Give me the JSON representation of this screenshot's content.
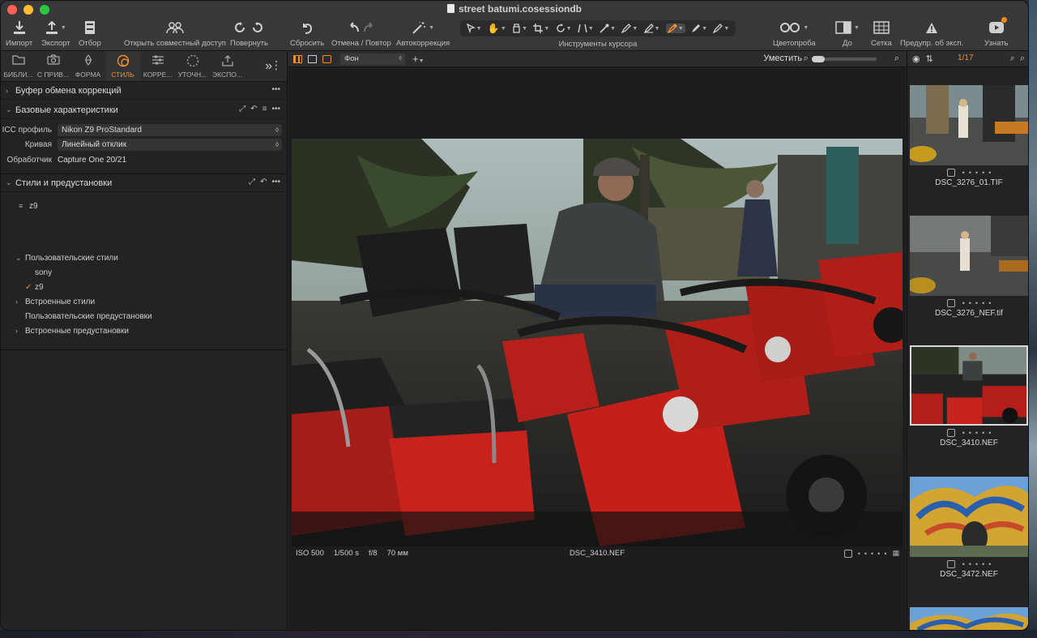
{
  "window": {
    "title": "street batumi.cosessiondb"
  },
  "toolbar": {
    "import": "Импорт",
    "export": "Экспорт",
    "select": "Отбор",
    "share": "Открыть совместный доступ",
    "rotate": "Повернуть",
    "reset": "Сбросить",
    "undo_redo": "Отмена / Повтор",
    "auto": "Автокоррекция",
    "cursor_tools": "Инструменты курсора",
    "color_picker": "Цветопроба",
    "before": "До",
    "grid": "Сетка",
    "warning": "Предупр. об эксп.",
    "learn": "Узнать"
  },
  "tool_tabs": [
    {
      "label": "БИБЛИ...",
      "icon": "folder-icon"
    },
    {
      "label": "С ПРИВ...",
      "icon": "camera-icon"
    },
    {
      "label": "ФОРМА",
      "icon": "lens-icon"
    },
    {
      "label": "СТИЛЬ",
      "icon": "style-icon"
    },
    {
      "label": "КОРРЕ...",
      "icon": "sliders-icon"
    },
    {
      "label": "УТОЧН...",
      "icon": "details-icon"
    },
    {
      "label": "ЭКСПО...",
      "icon": "export-tab-icon"
    }
  ],
  "clipboard": {
    "title": "Буфер обмена коррекций"
  },
  "basic": {
    "title": "Базовые характеристики",
    "icc_label": "ICC профиль",
    "icc_value": "Nikon Z9 ProStandard",
    "curve_label": "Кривая",
    "curve_value": "Линейный отклик",
    "engine_label": "Обработчик",
    "engine_value": "Capture One 20/21"
  },
  "styles": {
    "title": "Стили и предустановки",
    "applied": "z9",
    "user_styles": "Пользовательские стили",
    "user_items": [
      "sony",
      "z9"
    ],
    "builtin_styles": "Встроенные стили",
    "user_presets": "Пользовательские предустановки",
    "builtin_presets": "Встроенные предустановки"
  },
  "viewer": {
    "layer": "Фон",
    "fit": "Уместить",
    "iso": "ISO 500",
    "shutter": "1/500 s",
    "aperture": "f/8",
    "focal": "70 мм",
    "filename": "DSC_3410.NEF"
  },
  "browser": {
    "count": "1/17",
    "items": [
      {
        "name": "DSC_3276_01.TIF"
      },
      {
        "name": "DSC_3276_NEF.tif"
      },
      {
        "name": "DSC_3410.NEF",
        "selected": true
      },
      {
        "name": "DSC_3472.NEF"
      }
    ]
  },
  "colors": {
    "accent": "#f0902a",
    "bike_red": "#c8221c"
  }
}
